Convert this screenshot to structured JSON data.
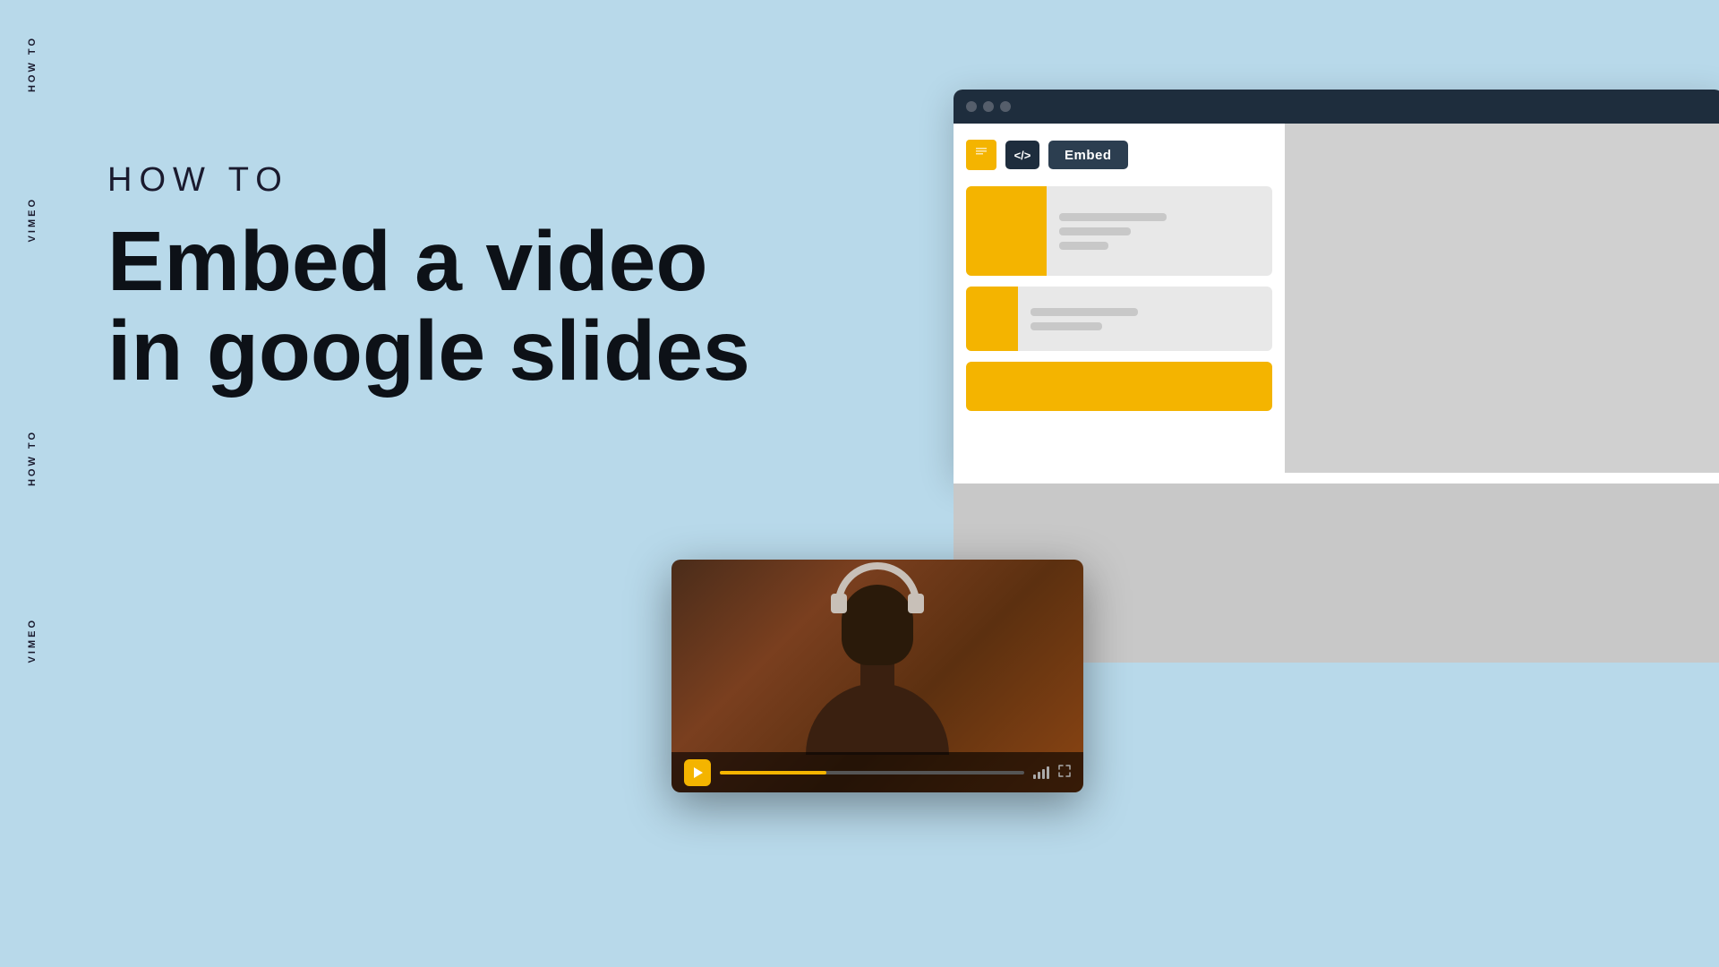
{
  "background_color": "#b8d9ea",
  "side_labels": {
    "how_to_top": "HOW TO",
    "vimeo_top": "VIMEO",
    "how_to_bottom": "HOW TO",
    "vimeo_bottom": "VIMEO"
  },
  "hero": {
    "label": "HOW TO",
    "title_line1": "Embed a video",
    "title_line2": "in google slides"
  },
  "browser": {
    "toolbar": {
      "code_label": "</>",
      "embed_label": "Embed"
    },
    "cards": [
      {
        "type": "large"
      },
      {
        "type": "medium"
      },
      {
        "type": "small"
      }
    ]
  },
  "video_player": {
    "progress_percent": 35
  }
}
